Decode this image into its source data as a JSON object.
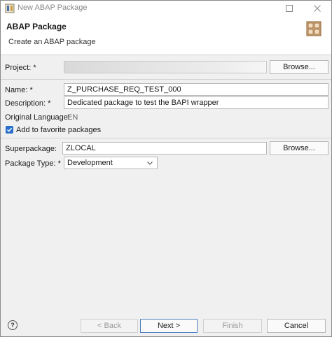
{
  "window": {
    "title": "New ABAP Package"
  },
  "header": {
    "title": "ABAP Package",
    "subtitle": "Create an ABAP package"
  },
  "form": {
    "project_label": "Project: *",
    "project_value": "",
    "project_browse": "Browse...",
    "name_label": "Name: *",
    "name_value": "Z_PURCHASE_REQ_TEST_000",
    "description_label": "Description: *",
    "description_value": "Dedicated package to test the BAPI wrapper",
    "original_language_label": "Original Language:",
    "original_language_value": "EN",
    "favorite_label": "Add to favorite packages",
    "favorite_checked": true,
    "superpackage_label": "Superpackage:",
    "superpackage_value": "ZLOCAL",
    "superpackage_browse": "Browse...",
    "package_type_label": "Package Type: *",
    "package_type_value": "Development"
  },
  "footer": {
    "help_symbol": "?",
    "back_label": "< Back",
    "next_label": "Next >",
    "finish_label": "Finish",
    "cancel_label": "Cancel"
  },
  "colors": {
    "accent": "#2a6fc9",
    "primary_border": "#4a7fc1"
  }
}
